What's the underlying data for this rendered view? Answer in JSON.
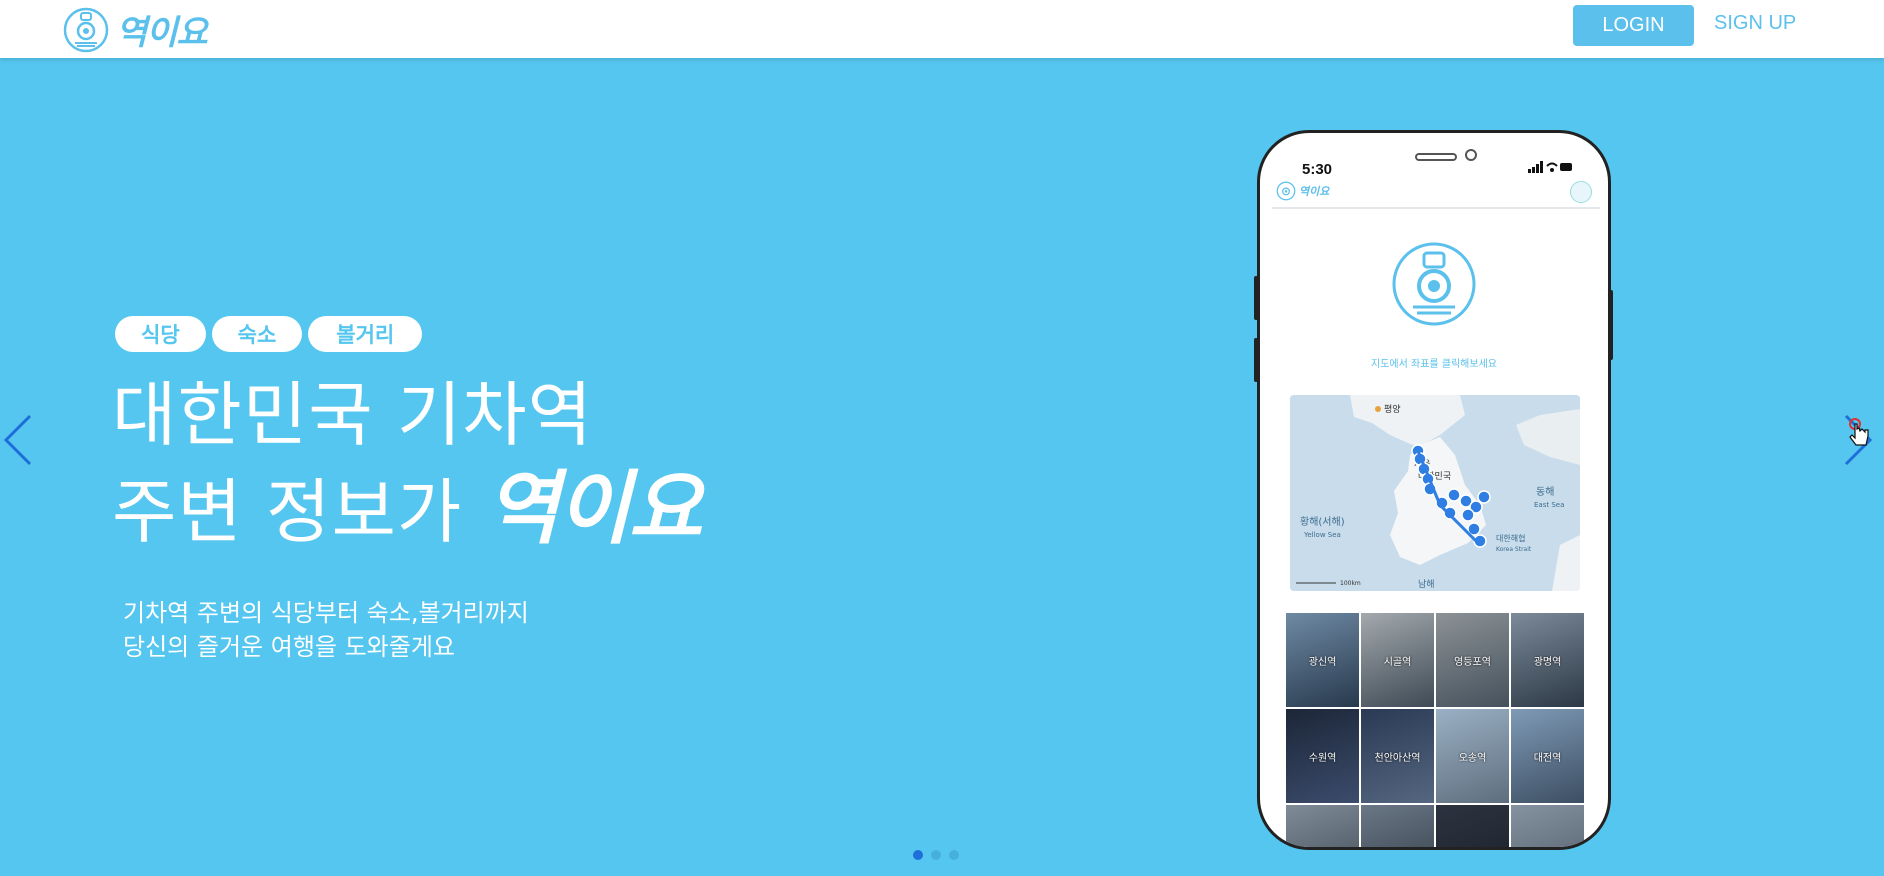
{
  "header": {
    "logo_text": "역이요",
    "login_label": "LOGIN",
    "signup_label": "SIGN UP"
  },
  "hero": {
    "tags": [
      "식당",
      "숙소",
      "볼거리"
    ],
    "headline_line1": "대한민국 기차역",
    "headline_line2_prefix": "주변 정보가",
    "headline_brand": "역이요",
    "sub_line1": "기차역 주변의 식당부터 숙소,볼거리까지",
    "sub_line2": "당신의 즐거운 여행을 도와줄게요",
    "slide_count": 3,
    "active_slide": 1
  },
  "phone": {
    "time": "5:30",
    "logo_text": "역이요",
    "caption": "지도에서 좌표를 클릭해보세요",
    "map_labels": {
      "pyongyang": "평양",
      "seoul": "서울",
      "korea": "대한민국",
      "yellow_sea": "황해(서해)",
      "yellow_sea_en": "Yellow Sea",
      "east_sea": "동해",
      "east_sea_en": "East Sea",
      "korea_strait": "대한해협",
      "korea_strait_en": "Korea Strait",
      "south": "남해",
      "scale": "100km"
    },
    "stations": [
      "광신역",
      "시골역",
      "영등포역",
      "광명역",
      "수원역",
      "천안아산역",
      "오송역",
      "대전역"
    ]
  },
  "colors": {
    "brand": "#5bc0eb",
    "hero_bg": "#54c6ef",
    "arrow": "#1e6fd9"
  }
}
